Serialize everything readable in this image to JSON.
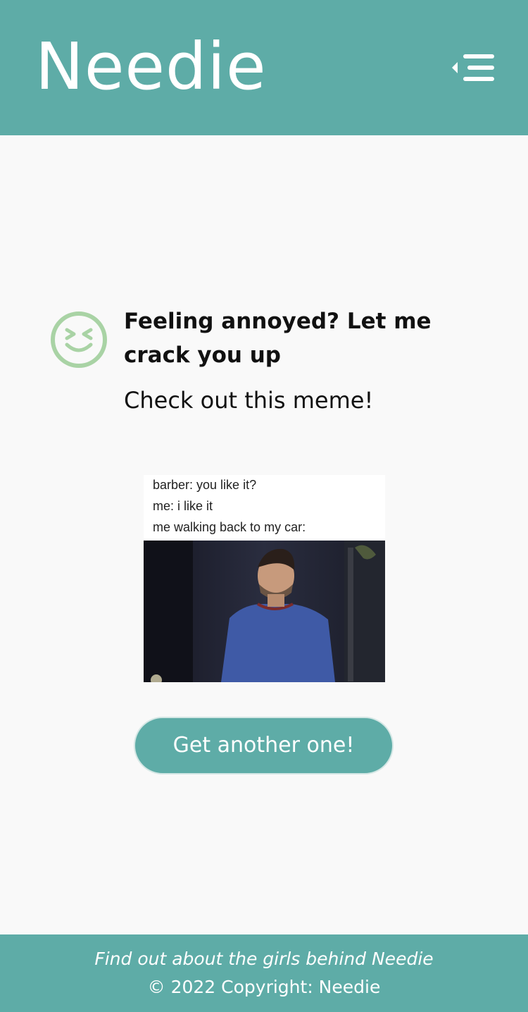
{
  "header": {
    "brand": "Needie",
    "menu_icon": "menu-collapse-icon"
  },
  "main": {
    "mood_icon": "laughing-face-icon",
    "title": "Feeling annoyed? Let me crack you up",
    "subtitle": "Check out this meme!",
    "meme": {
      "lines": [
        "barber: you like it?",
        "me: i like it",
        "me walking back to my car:"
      ]
    },
    "cta_label": "Get another one!"
  },
  "footer": {
    "about_link": "Find out about the girls behind Needie",
    "copyright": "© 2022 Copyright: Needie"
  },
  "colors": {
    "brand_teal": "#5eaca7",
    "emoji_green": "#a9d3a5",
    "background": "#f9f9f9"
  }
}
